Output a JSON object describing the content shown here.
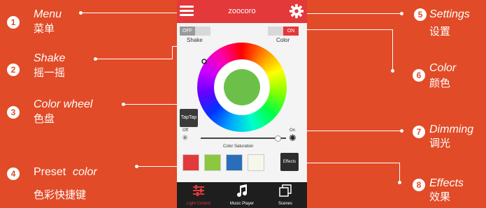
{
  "app": {
    "title": "zoocoro"
  },
  "toggles": {
    "shake": {
      "state": "OFF",
      "label": "Shake"
    },
    "color": {
      "state": "ON",
      "label": "Color"
    }
  },
  "taptap_label": "TapTap",
  "dimming": {
    "off_label": "Off",
    "on_label": "On",
    "level": 0.9
  },
  "saturation_label": "Color Saturation",
  "presets": [
    {
      "color": "#e3393a"
    },
    {
      "color": "#8dc63f"
    },
    {
      "color": "#2a6ebb"
    },
    {
      "color": "#f6f6ea"
    }
  ],
  "effects_label": "Effects",
  "wheel_center_color": "#6cc04a",
  "nav": [
    {
      "label": "Light Control",
      "icon": "sliders-icon",
      "active": true
    },
    {
      "label": "Music Player",
      "icon": "music-note-icon",
      "active": false
    },
    {
      "label": "Scenes",
      "icon": "scenes-icon",
      "active": false
    }
  ],
  "annotations": {
    "n1": {
      "num": "1",
      "en": "Menu",
      "zh": "菜单"
    },
    "n2": {
      "num": "2",
      "en": "Shake",
      "zh": "摇一摇"
    },
    "n3": {
      "num": "3",
      "en": "Color wheel",
      "zh": "色盘"
    },
    "n4": {
      "num": "4",
      "en_a": "Preset",
      "en_b": "color",
      "zh": "色彩快捷键"
    },
    "n5": {
      "num": "5",
      "en": "Settings",
      "zh": "设置"
    },
    "n6": {
      "num": "6",
      "en": "Color",
      "zh": "颜色"
    },
    "n7": {
      "num": "7",
      "en": "Dimming",
      "zh": "调光"
    },
    "n8": {
      "num": "8",
      "en": "Effects",
      "zh": "效果"
    }
  }
}
